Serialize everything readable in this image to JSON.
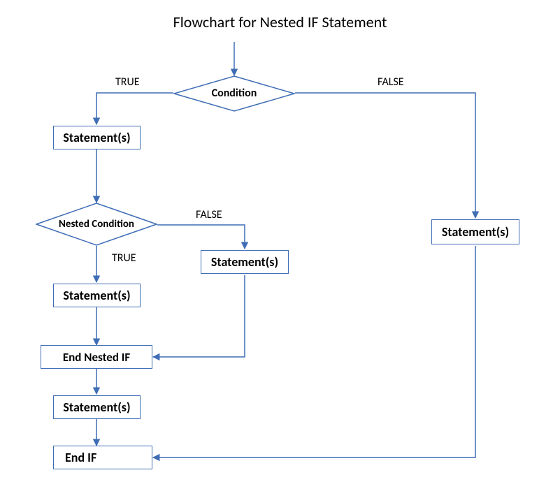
{
  "title": "Flowchart for Nested IF Statement",
  "labels": {
    "true": "TRUE",
    "false": "FALSE"
  },
  "nodes": {
    "condition": "Condition",
    "stmt_true_outer": "Statement(s)",
    "stmt_false_outer": "Statement(s)",
    "nested_condition": "Nested Condition",
    "stmt_nested_true": "Statement(s)",
    "stmt_nested_false": "Statement(s)",
    "end_nested_if": "End Nested IF",
    "stmt_after_nested": "Statement(s)",
    "end_if": "End IF"
  },
  "chart_data": {
    "type": "flowchart",
    "title": "Flowchart for Nested IF Statement",
    "nodes": [
      {
        "id": "start",
        "type": "start"
      },
      {
        "id": "condition",
        "type": "decision",
        "text": "Condition"
      },
      {
        "id": "stmt_true_outer",
        "type": "process",
        "text": "Statement(s)"
      },
      {
        "id": "stmt_false_outer",
        "type": "process",
        "text": "Statement(s)"
      },
      {
        "id": "nested_condition",
        "type": "decision",
        "text": "Nested Condition"
      },
      {
        "id": "stmt_nested_true",
        "type": "process",
        "text": "Statement(s)"
      },
      {
        "id": "stmt_nested_false",
        "type": "process",
        "text": "Statement(s)"
      },
      {
        "id": "end_nested_if",
        "type": "process",
        "text": "End Nested IF"
      },
      {
        "id": "stmt_after_nested",
        "type": "process",
        "text": "Statement(s)"
      },
      {
        "id": "end_if",
        "type": "process",
        "text": "End IF"
      }
    ],
    "edges": [
      {
        "from": "start",
        "to": "condition"
      },
      {
        "from": "condition",
        "to": "stmt_true_outer",
        "label": "TRUE"
      },
      {
        "from": "condition",
        "to": "stmt_false_outer",
        "label": "FALSE"
      },
      {
        "from": "stmt_true_outer",
        "to": "nested_condition"
      },
      {
        "from": "nested_condition",
        "to": "stmt_nested_true",
        "label": "TRUE"
      },
      {
        "from": "nested_condition",
        "to": "stmt_nested_false",
        "label": "FALSE"
      },
      {
        "from": "stmt_nested_true",
        "to": "end_nested_if"
      },
      {
        "from": "stmt_nested_false",
        "to": "end_nested_if"
      },
      {
        "from": "end_nested_if",
        "to": "stmt_after_nested"
      },
      {
        "from": "stmt_after_nested",
        "to": "end_if"
      },
      {
        "from": "stmt_false_outer",
        "to": "end_if"
      }
    ]
  }
}
